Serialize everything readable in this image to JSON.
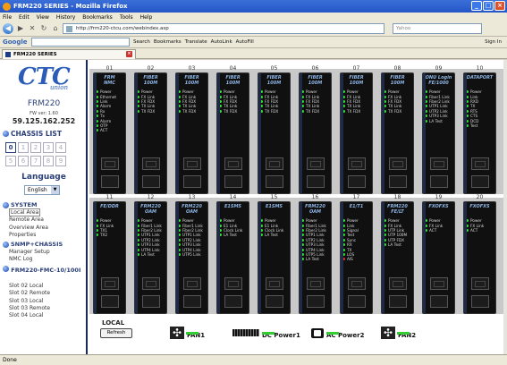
{
  "window": {
    "title": "FRM220 SERIES - Mozilla Firefox"
  },
  "menu": [
    "File",
    "Edit",
    "View",
    "History",
    "Bookmarks",
    "Tools",
    "Help"
  ],
  "nav": {
    "url": "http://frm220-ctcu.com/webindex.asp",
    "search_placeholder": "Yahoo"
  },
  "google_toolbar": {
    "brand": "Google",
    "items": [
      "Search",
      "Bookmarks",
      "Translate",
      "AutoLink",
      "AutoFill",
      "Sign In"
    ]
  },
  "tab": {
    "title": "FRM220 SERIES"
  },
  "sidebar": {
    "brand": "CTC",
    "brand_sub": "union",
    "model": "FRM220",
    "fw": "FW ver: 1.60",
    "ip": "59.125.162.252",
    "chassis_list_label": "CHASSIS LIST",
    "chassis": [
      "0",
      "1",
      "2",
      "3",
      "4",
      "5",
      "6",
      "7",
      "8",
      "9"
    ],
    "language_label": "Language",
    "language_value": "English",
    "system_label": "SYSTEM",
    "system_items": [
      "Local Area",
      "Remote Area",
      "Overview Area",
      "Properties"
    ],
    "snmp_label": "SNMP+CHASSIS",
    "snmp_items": [
      "Manager Setup",
      "NMC Log"
    ],
    "fmc_label": "FRM220-FMC-10/100I",
    "slot_items": [
      "Slot 02 Local",
      "Slot 02 Remote",
      "Slot 03 Local",
      "Slot 03 Remote",
      "Slot 04 Local"
    ]
  },
  "slots_row1": [
    {
      "num": "01",
      "title": "FRM\nNMC",
      "leds": [
        {
          "t": "Power",
          "c": "g"
        },
        {
          "t": "Ethernet",
          "c": "g"
        },
        {
          "t": "Link",
          "c": "g"
        },
        {
          "t": "Alarm",
          "c": "g"
        },
        {
          "t": "Rx",
          "c": "g"
        },
        {
          "t": "Tx",
          "c": "g"
        },
        {
          "t": "Alarm",
          "c": "g"
        },
        {
          "t": "OTP",
          "c": "g"
        },
        {
          "t": "ACT",
          "c": "g"
        }
      ]
    },
    {
      "num": "02",
      "title": "FIBER\n100M",
      "leds": [
        {
          "t": "Power",
          "c": "g"
        },
        {
          "t": "FX Link",
          "c": "g"
        },
        {
          "t": "FX FDX",
          "c": "g"
        },
        {
          "t": "TX Link",
          "c": "g"
        },
        {
          "t": "TX FDX",
          "c": "g"
        }
      ]
    },
    {
      "num": "03",
      "title": "FIBER\n100M",
      "leds": [
        {
          "t": "Power",
          "c": "g"
        },
        {
          "t": "FX Link",
          "c": "g"
        },
        {
          "t": "FX FDX",
          "c": "g"
        },
        {
          "t": "TX Link",
          "c": "g"
        },
        {
          "t": "TX FDX",
          "c": "g"
        }
      ]
    },
    {
      "num": "04",
      "title": "FIBER\n100M",
      "leds": [
        {
          "t": "Power",
          "c": "g"
        },
        {
          "t": "FX Link",
          "c": "g"
        },
        {
          "t": "FX FDX",
          "c": "g"
        },
        {
          "t": "TX Link",
          "c": "g"
        },
        {
          "t": "TX FDX",
          "c": "g"
        }
      ]
    },
    {
      "num": "05",
      "title": "FIBER\n100M",
      "leds": [
        {
          "t": "Power",
          "c": "g"
        },
        {
          "t": "FX Link",
          "c": "g"
        },
        {
          "t": "FX FDX",
          "c": "g"
        },
        {
          "t": "TX Link",
          "c": "g"
        },
        {
          "t": "TX FDX",
          "c": "g"
        }
      ]
    },
    {
      "num": "06",
      "title": "FIBER\n100M",
      "leds": [
        {
          "t": "Power",
          "c": "g"
        },
        {
          "t": "FX Link",
          "c": "g"
        },
        {
          "t": "FX FDX",
          "c": "g"
        },
        {
          "t": "TX Link",
          "c": "g"
        },
        {
          "t": "TX FDX",
          "c": "g"
        }
      ]
    },
    {
      "num": "07",
      "title": "FIBER\n100M",
      "leds": [
        {
          "t": "Power",
          "c": "g"
        },
        {
          "t": "FX Link",
          "c": "g"
        },
        {
          "t": "FX FDX",
          "c": "g"
        },
        {
          "t": "TX Link",
          "c": "g"
        },
        {
          "t": "TX FDX",
          "c": "g"
        }
      ]
    },
    {
      "num": "08",
      "title": "FIBER\n100M",
      "leds": [
        {
          "t": "Power",
          "c": "g"
        },
        {
          "t": "FX Link",
          "c": "g"
        },
        {
          "t": "FX FDX",
          "c": "g"
        },
        {
          "t": "TX Link",
          "c": "g"
        },
        {
          "t": "TX FDX",
          "c": "g"
        }
      ]
    },
    {
      "num": "09",
      "title": "ONU Login\nFE/1000",
      "leds": [
        {
          "t": "Power",
          "c": "g"
        },
        {
          "t": "Fiber1 Link",
          "c": "g"
        },
        {
          "t": "Fiber2 Link",
          "c": "g"
        },
        {
          "t": "UTP1 Link",
          "c": "g"
        },
        {
          "t": "UTP2 Link",
          "c": "g"
        },
        {
          "t": "UTP3 Link",
          "c": "g"
        },
        {
          "t": "LA Test",
          "c": "g"
        }
      ]
    },
    {
      "num": "10",
      "title": "DATAPORT",
      "leds": [
        {
          "t": "Power",
          "c": "g"
        },
        {
          "t": "Link",
          "c": "g"
        },
        {
          "t": "RXD",
          "c": "g"
        },
        {
          "t": "TX",
          "c": "g"
        },
        {
          "t": "RTS",
          "c": "g"
        },
        {
          "t": "CTS",
          "c": "g"
        },
        {
          "t": "DCD",
          "c": "g"
        },
        {
          "t": "Test",
          "c": "g"
        }
      ]
    }
  ],
  "slots_row2": [
    {
      "num": "11",
      "title": "FE/DDR",
      "leds": [
        {
          "t": "Power",
          "c": "g"
        },
        {
          "t": "FX Link",
          "c": "g"
        },
        {
          "t": "TX1",
          "c": "g"
        },
        {
          "t": "TX2",
          "c": "g"
        }
      ]
    },
    {
      "num": "12",
      "title": "FRM220\nOAM",
      "leds": [
        {
          "t": "Power",
          "c": "g"
        },
        {
          "t": "Fiber1 Link",
          "c": "g"
        },
        {
          "t": "Fiber2 Link",
          "c": "g"
        },
        {
          "t": "UTP1 Link",
          "c": "g"
        },
        {
          "t": "UTP2 Link",
          "c": "g"
        },
        {
          "t": "UTP3 Link",
          "c": "g"
        },
        {
          "t": "UTP4 Link",
          "c": "g"
        },
        {
          "t": "LA Test",
          "c": "g"
        }
      ]
    },
    {
      "num": "13",
      "title": "FRM220\nOAM",
      "leds": [
        {
          "t": "Power",
          "c": "g"
        },
        {
          "t": "Fiber1 Link",
          "c": "g"
        },
        {
          "t": "Fiber2 Link",
          "c": "g"
        },
        {
          "t": "UTP1 Link",
          "c": "g"
        },
        {
          "t": "UTP2 Link",
          "c": "g"
        },
        {
          "t": "UTP3 Link",
          "c": "g"
        },
        {
          "t": "UTP4 Link",
          "c": "g"
        },
        {
          "t": "UTP5 Link",
          "c": "g"
        }
      ]
    },
    {
      "num": "14",
      "title": "E1SMS",
      "leds": [
        {
          "t": "Power",
          "c": "g"
        },
        {
          "t": "E1 Link",
          "c": "g"
        },
        {
          "t": "Clock Link",
          "c": "g"
        },
        {
          "t": "LA Test",
          "c": "g"
        }
      ]
    },
    {
      "num": "15",
      "title": "E1SMS",
      "leds": [
        {
          "t": "Power",
          "c": "g"
        },
        {
          "t": "E1 Link",
          "c": "g"
        },
        {
          "t": "Clock Link",
          "c": "g"
        },
        {
          "t": "LA Test",
          "c": "g"
        }
      ]
    },
    {
      "num": "16",
      "title": "FRM220\nOAM",
      "leds": [
        {
          "t": "Power",
          "c": "g"
        },
        {
          "t": "Fiber1 Link",
          "c": "g"
        },
        {
          "t": "Fiber2 Link",
          "c": "g"
        },
        {
          "t": "UTP1 Link",
          "c": "g"
        },
        {
          "t": "UTP2 Link",
          "c": "g"
        },
        {
          "t": "UTP3 Link",
          "c": "g"
        },
        {
          "t": "UTP4 Link",
          "c": "g"
        },
        {
          "t": "UTP5 Link",
          "c": "g"
        },
        {
          "t": "LA Test",
          "c": "g"
        }
      ]
    },
    {
      "num": "17",
      "title": "E1/T1",
      "leds": [
        {
          "t": "Power",
          "c": "g"
        },
        {
          "t": "Link",
          "c": "g"
        },
        {
          "t": "Signal",
          "c": "g"
        },
        {
          "t": "Test",
          "c": "g"
        },
        {
          "t": "Sync",
          "c": "g"
        },
        {
          "t": "RX",
          "c": "g"
        },
        {
          "t": "TX",
          "c": "g"
        },
        {
          "t": "LOS",
          "c": "g"
        },
        {
          "t": "AIS",
          "c": "r"
        }
      ]
    },
    {
      "num": "18",
      "title": "FRM220\nFE/LT",
      "leds": [
        {
          "t": "Power",
          "c": "g"
        },
        {
          "t": "FX Link",
          "c": "g"
        },
        {
          "t": "UTP Link",
          "c": "g"
        },
        {
          "t": "UTP 100M",
          "c": "g"
        },
        {
          "t": "UTP FDX",
          "c": "g"
        },
        {
          "t": "LA Test",
          "c": "g"
        }
      ]
    },
    {
      "num": "19",
      "title": "FXOFXS",
      "leds": [
        {
          "t": "Power",
          "c": "g"
        },
        {
          "t": "FX Link",
          "c": "g"
        },
        {
          "t": "ACT",
          "c": "g"
        }
      ]
    },
    {
      "num": "20",
      "title": "FXOFXS",
      "leds": [
        {
          "t": "Power",
          "c": "g"
        },
        {
          "t": "FX Link",
          "c": "g"
        },
        {
          "t": "ACT",
          "c": "g"
        }
      ]
    }
  ],
  "bottom": {
    "local_label": "LOCAL",
    "refresh_label": "Refresh",
    "fan1_label": "FAN1",
    "dc_label": "DC Power1",
    "ac_label": "AC Power2",
    "fan2_label": "FAN2"
  },
  "status": {
    "text": "Done"
  },
  "colors": {
    "led_on": "#33e033",
    "led_alarm": "#e03030",
    "card_bg": "#101010",
    "accent": "#2b3f78"
  }
}
